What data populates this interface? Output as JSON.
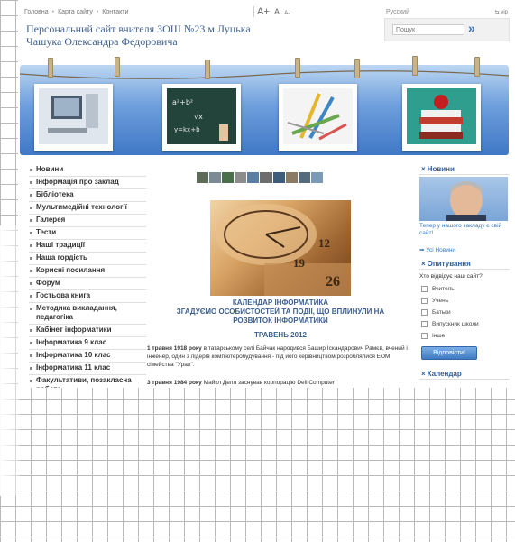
{
  "topbar": {
    "nav": [
      "Головна",
      "Карта сайту",
      "Контакти"
    ],
    "font_large": "A+",
    "font_mid": "A",
    "font_small": "A-",
    "language": "Русский",
    "version": "⇆ vip"
  },
  "site": {
    "title_line1": "Персональний сайт вчителя ЗОШ №23 м.Луцька",
    "title_line2": "Чашука Олександра Федоровича"
  },
  "search": {
    "placeholder": "Пошук",
    "button_glyph": "»"
  },
  "sidebar": {
    "items": [
      "Новини",
      "Інформація про заклад",
      "Бібліотека",
      "Мультимедійні технології",
      "Галерея",
      "Тести",
      "Наші традиції",
      "Наша гордість",
      "Корисні посилання",
      "Форум",
      "Гостьова книга",
      "Методика викладання, педагогіка",
      "Кабінет інформатики",
      "Інформатика 9 клас",
      "Інформатика 10 клас",
      "Інформатика 11 клас",
      "Факультативи, позакласна робота,"
    ]
  },
  "article": {
    "title_line1": "КАЛЕНДАР ІНФОРМАТИКА",
    "title_line2": "ЗГАДУЄМО ОСОБИСТОСТЕЙ ТА ПОДІЇ, ЩО ВПЛИНУЛИ НА",
    "title_line3": "РОЗВИТОК ІНФОРМАТИКИ",
    "month": "ТРАВЕНЬ 2012",
    "p1_bold": "1 травня 1918 року",
    "p1_text": " в татарському селі Байчак народився Башир Іскандарович Рамєв, вчений і інженер, один з лідерів комп'ютеробудування - під його керівництвом розроблялися ЕОМ сімейства \"Урал\".",
    "p2_bold": "3 травня 1984 року",
    "p2_text": " Майкл Делл заснував корпорацію Dell Computer",
    "calendar_numbers": [
      "12",
      "19",
      "26"
    ]
  },
  "right": {
    "news_title": "Новини",
    "news_caption": "Тепер у нашого закладу є свій сайт!",
    "all_news": "➡ Усі Новини",
    "poll_title": "Опитування",
    "poll_question": "Хто відвідує наш сайт?",
    "poll_options": [
      "Вчитель",
      "Учень",
      "Батьки",
      "Випускник школи",
      "Інше"
    ],
    "vote_button": "Відповісти!",
    "calendar_title": "Календар"
  },
  "colors": {
    "title_blue": "#3d5f8f",
    "banner_blue": "#3f78c6",
    "link_blue": "#3a7bbf"
  }
}
